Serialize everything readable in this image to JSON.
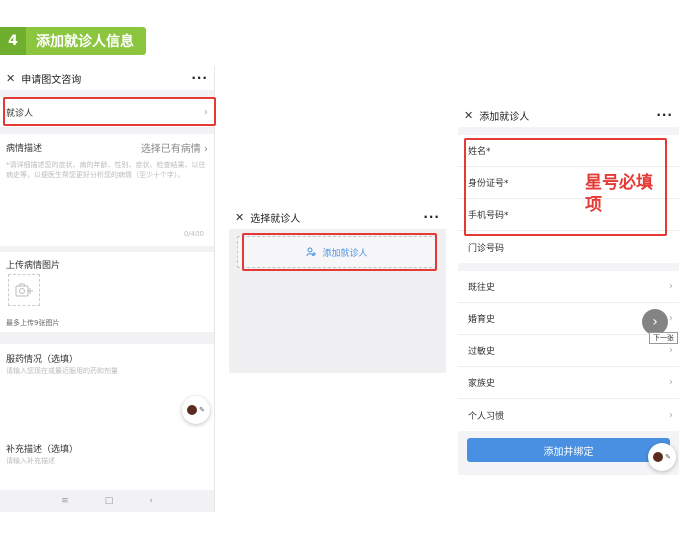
{
  "step": {
    "number": "4",
    "title": "添加就诊人信息"
  },
  "screen1": {
    "title": "申请图文咨询",
    "more": "···",
    "patient_row": "就诊人",
    "desc_label": "病情描述",
    "desc_action": "选择已有病情",
    "desc_placeholder": "*请详细描述您的症状、病的年龄、性别、症状、检查结果、以往病史等，以便医生帮您更好分析您的病情（至少十个字）。",
    "counter": "0/400",
    "upload_label": "上传病情图片",
    "upload_hint": "最多上传9张图片",
    "med_label": "服药情况（选填）",
    "med_placeholder": "请输入您现在或最近服用的药和剂量",
    "extra_label": "补充描述（选填）",
    "extra_placeholder": "请输入补充描述"
  },
  "screen2": {
    "title": "选择就诊人",
    "more": "···",
    "add_label": "添加就诊人"
  },
  "screen3": {
    "title": "添加就诊人",
    "more": "···",
    "fields": [
      "姓名*",
      "身份证号*",
      "手机号码*",
      "门诊号码"
    ],
    "history": [
      "既往史",
      "婚育史",
      "过敏史",
      "家族史",
      "个人习惯"
    ],
    "submit": "添加并绑定",
    "next_tip": "下一张"
  },
  "annotation": {
    "line1": "星号必填",
    "line2": "项"
  },
  "colors": {
    "red": "#e53935",
    "blue": "#4a90e2",
    "green": "#8cc63f"
  }
}
